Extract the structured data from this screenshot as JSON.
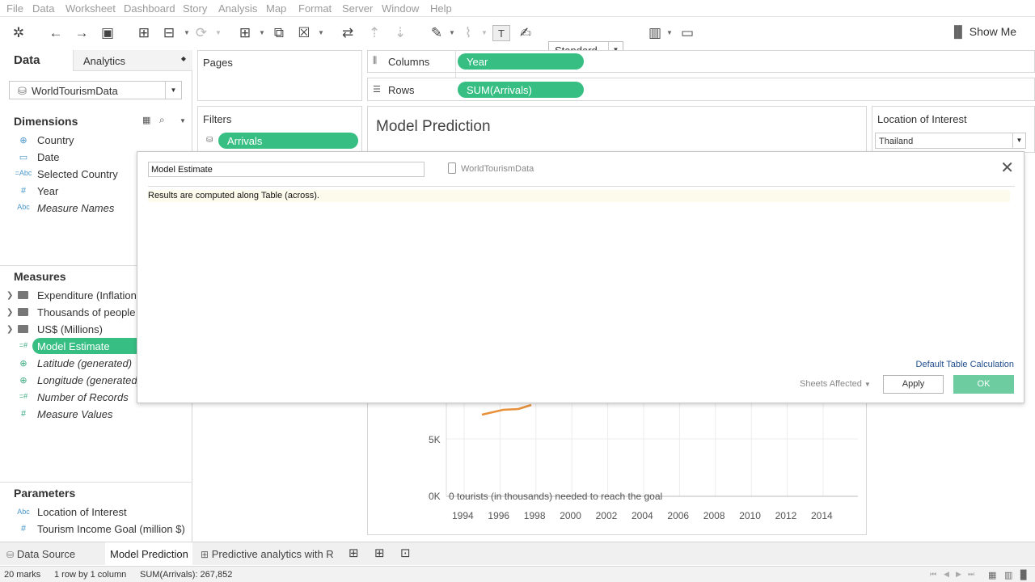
{
  "menu": [
    "File",
    "Data",
    "Worksheet",
    "Dashboard",
    "Story",
    "Analysis",
    "Map",
    "Format",
    "Server",
    "Window",
    "Help"
  ],
  "toolbar": {
    "fit_select": "Standard",
    "show_me": "Show Me"
  },
  "data_pane": {
    "tab_data": "Data",
    "tab_analytics": "Analytics",
    "datasource": "WorldTourismData",
    "dimensions_title": "Dimensions",
    "dimensions": [
      {
        "icon": "globe-icon",
        "glyph": "⊕",
        "label": "Country"
      },
      {
        "icon": "calendar-icon",
        "glyph": "▭",
        "label": "Date"
      },
      {
        "icon": "string-icon",
        "glyph": "=Abc",
        "label": "Selected Country"
      },
      {
        "icon": "number-icon",
        "glyph": "#",
        "label": "Year"
      },
      {
        "icon": "string-icon",
        "glyph": "Abc",
        "label": "Measure Names"
      }
    ],
    "measures_title": "Measures",
    "measure_folders": [
      "Expenditure (Inflation ...",
      "Thousands of people",
      "US$ (Millions)"
    ],
    "measures": [
      {
        "glyph": "=#",
        "label": "Model Estimate"
      },
      {
        "glyph": "⊕",
        "label": "Latitude (generated)"
      },
      {
        "glyph": "⊕",
        "label": "Longitude (generated)"
      },
      {
        "glyph": "=#",
        "label": "Number of Records"
      },
      {
        "glyph": "#",
        "label": "Measure Values"
      }
    ],
    "parameters_title": "Parameters",
    "parameters": [
      {
        "glyph": "Abc",
        "label": "Location of Interest"
      },
      {
        "glyph": "#",
        "label": "Tourism Income Goal (million $)"
      }
    ]
  },
  "shelves": {
    "pages": "Pages",
    "filters": "Filters",
    "filter_pill": "Arrivals",
    "columns": "Columns",
    "columns_pill": "Year",
    "rows": "Rows",
    "rows_pill": "SUM(Arrivals)"
  },
  "view": {
    "title": "Model Prediction"
  },
  "parameter_card": {
    "title": "Location of Interest",
    "value": "Thailand"
  },
  "chart_data": {
    "type": "line",
    "title": "Model Prediction",
    "x": [
      1994,
      1996,
      1998
    ],
    "y_ticks": [
      "5K",
      "0K"
    ],
    "x_ticks": [
      "1994",
      "1996",
      "1998",
      "2000",
      "2002",
      "2004",
      "2006",
      "2008",
      "2010",
      "2012",
      "2014"
    ],
    "annotation": "0 tourists (in thousands) needed to reach the goal",
    "line_color": "#e8913a"
  },
  "dialog": {
    "calc_name": "Model Estimate",
    "source": "WorldTourismData",
    "message": "Results are computed along Table (across).",
    "default_link": "Default Table Calculation",
    "sheets_affected": "Sheets Affected",
    "apply": "Apply",
    "ok": "OK"
  },
  "tabs": {
    "data_source": "Data Source",
    "sheet1": "Model Prediction",
    "sheet2": "Predictive analytics with R"
  },
  "status": {
    "marks": "20 marks",
    "dims": "1 row by 1 column",
    "sum": "SUM(Arrivals): 267,852"
  }
}
